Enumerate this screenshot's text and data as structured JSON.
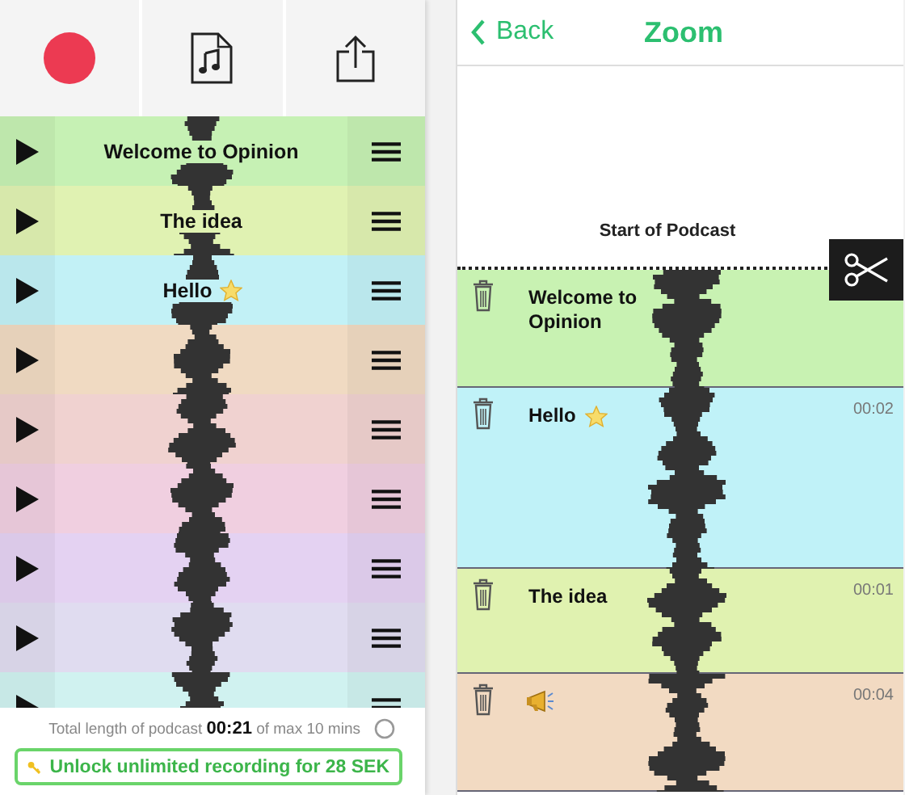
{
  "toolbar": {
    "buttons": [
      {
        "kind": "record"
      },
      {
        "kind": "music_file"
      },
      {
        "kind": "share"
      }
    ]
  },
  "clips": [
    {
      "title": "Welcome to Opinion",
      "color": "#c6f1b4"
    },
    {
      "title": "The idea",
      "color": "#e0f2b2"
    },
    {
      "title": "Hello",
      "kind": "starred",
      "color": "#c2f1f6"
    },
    {
      "color": "#f0dac2"
    },
    {
      "color": "#f0d2d0"
    },
    {
      "color": "#f0cfe0"
    },
    {
      "color": "#e4d2f2"
    },
    {
      "color": "#e0dcf0"
    },
    {
      "color": "#d0f2f0"
    }
  ],
  "footer": {
    "total_text": "Total length of podcast **00:21** of max 10 mins",
    "unlock_button": "Unlock unlimited recording for 28 SEK"
  },
  "zoom": {
    "back": "Back",
    "title": "Zoom",
    "start_label": "Start of Podcast",
    "segments": [
      {
        "title": "Welcome to Opinion",
        "color": "#c8f2b2"
      },
      {
        "title": "Hello",
        "kind": "starred",
        "time": "00:02",
        "color": "#c0f2f8"
      },
      {
        "title": "The idea",
        "time": "00:01",
        "color": "#e0f2b0"
      },
      {
        "kind": "megaphone",
        "time": "00:04",
        "color": "#f2dac2"
      }
    ]
  }
}
